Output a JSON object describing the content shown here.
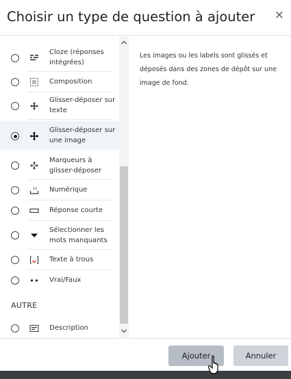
{
  "dialog": {
    "title": "Choisir un type de question à ajouter",
    "close_label": "×"
  },
  "question_types": [
    {
      "label": "Cloze (réponses intégrées)",
      "icon": "cloze-icon",
      "selected": false
    },
    {
      "label": "Composition",
      "icon": "essay-icon",
      "selected": false
    },
    {
      "label": "Glisser-déposer sur texte",
      "icon": "move-icon",
      "selected": false
    },
    {
      "label": "Glisser-déposer sur une image",
      "icon": "move-icon",
      "selected": true
    },
    {
      "label": "Marqueurs à glisser-déposer",
      "icon": "move-markers-icon",
      "selected": false
    },
    {
      "label": "Numérique",
      "icon": "numerical-icon",
      "selected": false
    },
    {
      "label": "Réponse courte",
      "icon": "short-answer-icon",
      "selected": false
    },
    {
      "label": "Sélectionner les mots manquants",
      "icon": "dropdown-icon",
      "selected": false
    },
    {
      "label": "Texte à trous",
      "icon": "gapfill-icon",
      "selected": false
    },
    {
      "label": "Vrai/Faux",
      "icon": "true-false-icon",
      "selected": false
    }
  ],
  "other_section": {
    "heading": "AUTRE",
    "items": [
      {
        "label": "Description",
        "icon": "description-icon",
        "selected": false
      }
    ]
  },
  "scrollbar": {
    "up_arrow": "^",
    "down_arrow": "v"
  },
  "description": "Les images ou les labels sont glissés et déposés dans des zones de dépôt sur une image de fond.",
  "footer": {
    "add_label": "Ajouter",
    "cancel_label": "Annuler"
  }
}
